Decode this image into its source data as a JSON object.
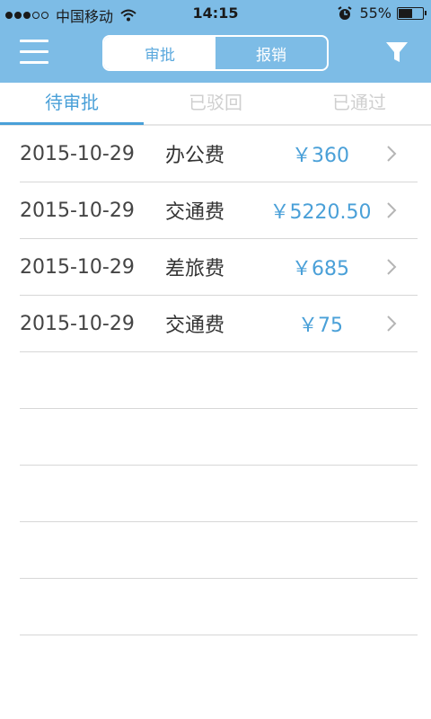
{
  "status_bar": {
    "carrier": "中国移动",
    "time": "14:15",
    "battery_percent": "55%",
    "battery_level": 0.55
  },
  "header": {
    "segments": [
      "审批",
      "报销"
    ],
    "active_segment": "审批"
  },
  "tabs": [
    {
      "label": "待审批",
      "active": true
    },
    {
      "label": "已驳回",
      "active": false
    },
    {
      "label": "已通过",
      "active": false
    }
  ],
  "records": [
    {
      "date": "2015-10-29",
      "type": "办公费",
      "amount": "￥360"
    },
    {
      "date": "2015-10-29",
      "type": "交通费",
      "amount": "￥5220.50"
    },
    {
      "date": "2015-10-29",
      "type": "差旅费",
      "amount": "￥685"
    },
    {
      "date": "2015-10-29",
      "type": "交通费",
      "amount": "￥75"
    }
  ],
  "colors": {
    "header_bg": "#7dbce6",
    "accent": "#4aa0d8"
  }
}
